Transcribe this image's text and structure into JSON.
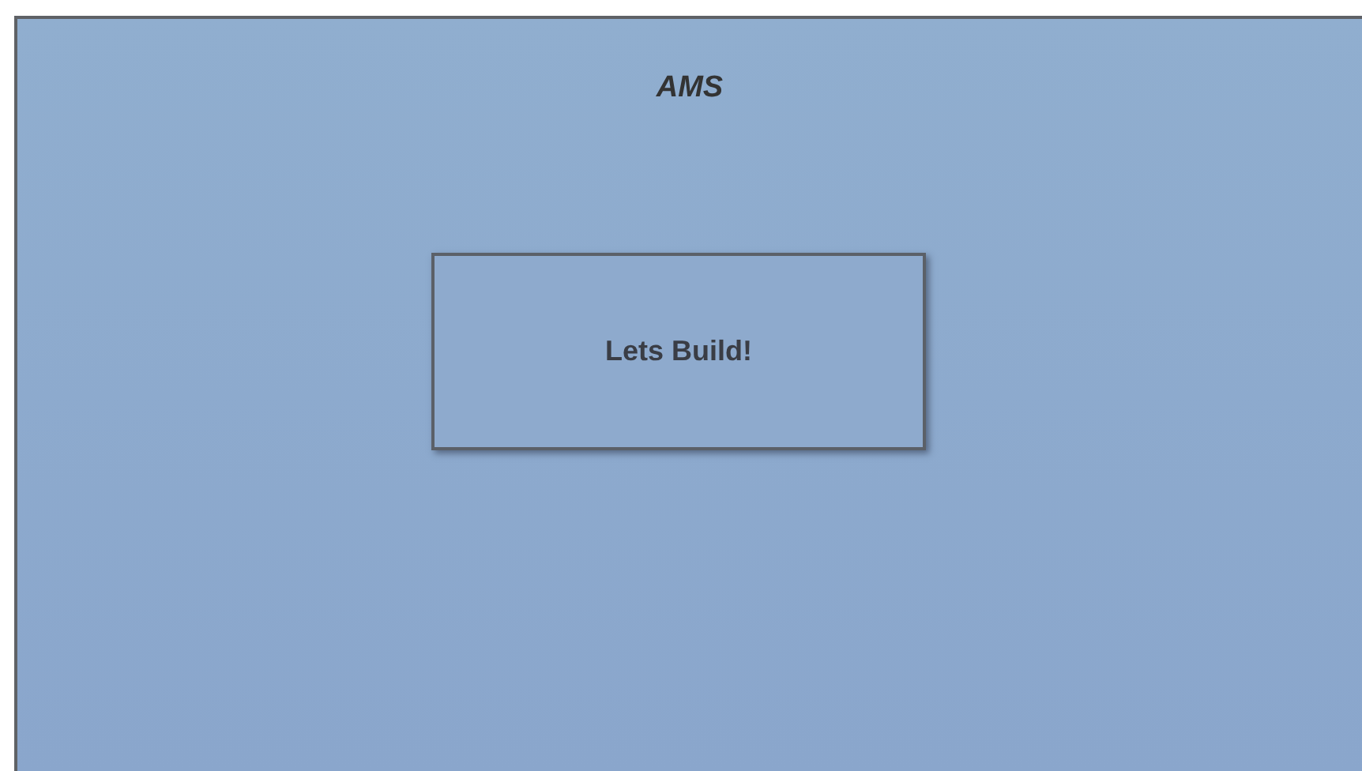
{
  "page": {
    "title": "AMS"
  },
  "button": {
    "label": "Lets Build!"
  }
}
